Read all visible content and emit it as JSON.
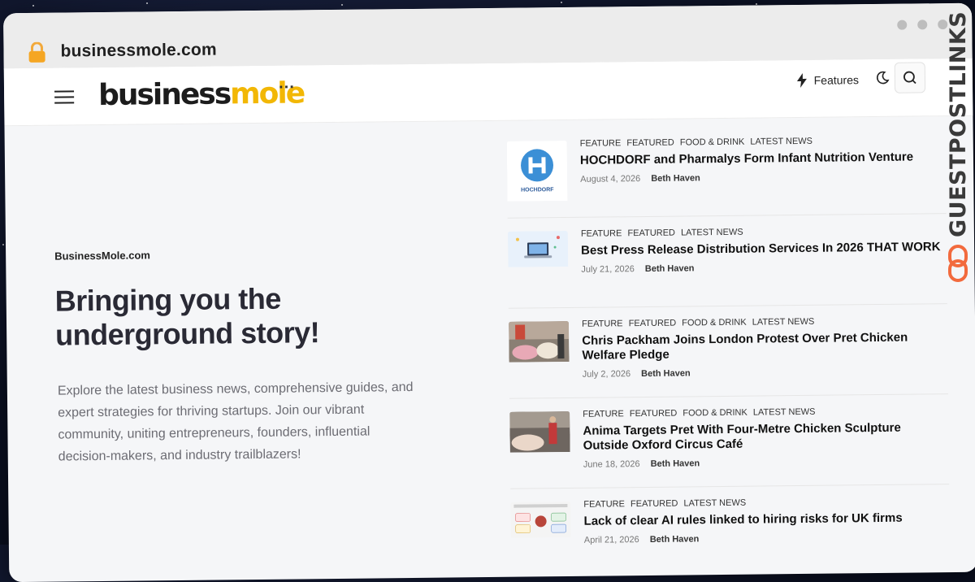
{
  "browser": {
    "url": "businessmole.com"
  },
  "header": {
    "logo_part1": "business",
    "logo_part2": "mole",
    "more_label": "···",
    "features_label": "Features"
  },
  "hero": {
    "kicker": "BusinessMole.com",
    "title": "Bringing you the underground story!",
    "description": "Explore the latest business news, comprehensive guides, and expert strategies for thriving startups. Join our vibrant community, uniting entrepreneurs, founders, influential decision-makers, and industry trailblazers!"
  },
  "news": [
    {
      "tags": [
        "FEATURE",
        "FEATURED",
        "FOOD & DRINK",
        "LATEST NEWS"
      ],
      "title": "HOCHDORF and Pharmalys Form Infant Nutrition Venture",
      "date": "August 4, 2026",
      "author": "Beth Haven",
      "thumb_caption": "HOCHDORF"
    },
    {
      "tags": [
        "FEATURE",
        "FEATURED",
        "LATEST NEWS"
      ],
      "title": "Best Press Release Distribution Services In 2026 THAT WORK",
      "date": "July 21, 2026",
      "author": "Beth Haven"
    },
    {
      "tags": [
        "FEATURE",
        "FEATURED",
        "FOOD & DRINK",
        "LATEST NEWS"
      ],
      "title": "Chris Packham Joins London Protest Over Pret Chicken Welfare Pledge",
      "date": "July 2, 2026",
      "author": "Beth Haven"
    },
    {
      "tags": [
        "FEATURE",
        "FEATURED",
        "FOOD & DRINK",
        "LATEST NEWS"
      ],
      "title": "Anima Targets Pret With Four-Metre Chicken Sculpture Outside Oxford Circus Café",
      "date": "June 18, 2026",
      "author": "Beth Haven"
    },
    {
      "tags": [
        "FEATURE",
        "FEATURED",
        "LATEST NEWS"
      ],
      "title": "Lack of clear AI rules linked to hiring risks for UK firms",
      "date": "April 21, 2026",
      "author": "Beth Haven"
    }
  ],
  "badge": {
    "text": "GUESTPOSTLINKS"
  },
  "colors": {
    "logo_accent": "#f2b705",
    "badge_icon": "#f26a3d"
  }
}
